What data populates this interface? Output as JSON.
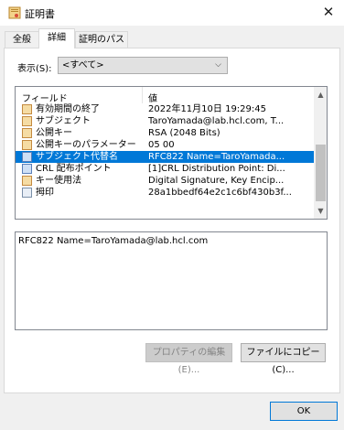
{
  "window": {
    "title": "証明書",
    "close_glyph": "✕"
  },
  "tabs": [
    {
      "label": "全般"
    },
    {
      "label": "詳細"
    },
    {
      "label": "証明のパス"
    }
  ],
  "show": {
    "label": "表示(S):",
    "selected": "<すべて>"
  },
  "list": {
    "headers": [
      "フィールド",
      "値"
    ],
    "rows": [
      {
        "field": "有効期間の終了",
        "value": "2022年11月10日 19:29:45"
      },
      {
        "field": "サブジェクト",
        "value": "TaroYamada@lab.hcl.com, T..."
      },
      {
        "field": "公開キー",
        "value": "RSA (2048 Bits)"
      },
      {
        "field": "公開キーのパラメーター",
        "value": "05 00"
      },
      {
        "field": "サブジェクト代替名",
        "value": "RFC822 Name=TaroYamada..."
      },
      {
        "field": "CRL 配布ポイント",
        "value": "[1]CRL Distribution Point: Di..."
      },
      {
        "field": "キー使用法",
        "value": "Digital Signature, Key Encip..."
      },
      {
        "field": "拇印",
        "value": "28a1bbedf64e2c1c6bf430b3f..."
      }
    ],
    "selected_index": 4
  },
  "detail_text": "RFC822 Name=TaroYamada@lab.hcl.com",
  "buttons": {
    "edit_properties": "プロパティの編集(E)...",
    "copy_to_file": "ファイルにコピー(C)...",
    "ok": "OK"
  }
}
